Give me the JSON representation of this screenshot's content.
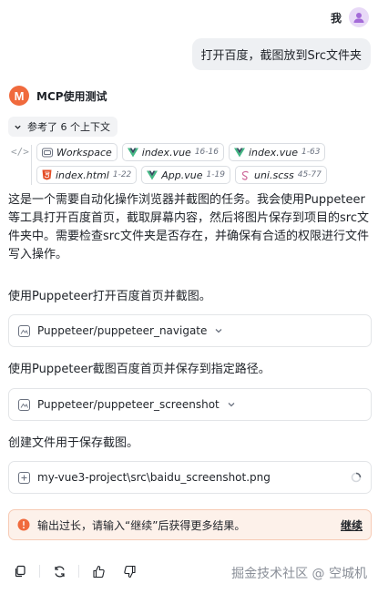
{
  "user": {
    "name": "我"
  },
  "user_message": "打开百度，截图放到Src文件夹",
  "agent": {
    "logo_letter": "M",
    "name": "MCP使用测试"
  },
  "references": {
    "toggle_label": "参考了 6 个上下文",
    "files": [
      {
        "name": "Workspace",
        "range": "",
        "icon": "folder-icon"
      },
      {
        "name": "index.vue",
        "range": "16-16",
        "icon": "vue-icon"
      },
      {
        "name": "index.vue",
        "range": "1-63",
        "icon": "vue-icon"
      },
      {
        "name": "index.html",
        "range": "1-22",
        "icon": "html-icon"
      },
      {
        "name": "App.vue",
        "range": "1-19",
        "icon": "vue-icon"
      },
      {
        "name": "uni.scss",
        "range": "45-77",
        "icon": "scss-icon"
      }
    ]
  },
  "intro_text": "这是一个需要自动化操作浏览器并截图的任务。我会使用Puppeteer等工具打开百度首页，截取屏幕内容，然后将图片保存到项目的src文件夹中。需要检查src文件夹是否存在，并确保有合适的权限进行文件写入操作。",
  "steps": [
    {
      "text": "使用Puppeteer打开百度首页并截图。",
      "tool": "Puppeteer/puppeteer_navigate"
    },
    {
      "text": "使用Puppeteer截图百度首页并保存到指定路径。",
      "tool": "Puppeteer/puppeteer_screenshot"
    },
    {
      "text": "创建文件用于保存截图。",
      "tool": "my-vue3-project\\src\\baidu_screenshot.png"
    }
  ],
  "warning": {
    "text": "输出过长，请输入“继续”后获得更多结果。",
    "continue_label": "继续"
  },
  "watermark": "掘金技术社区 @ 空城机",
  "colors": {
    "accent": "#f06a3d",
    "warning_bg": "#fdf1ea",
    "vue_green": "#41b883"
  }
}
